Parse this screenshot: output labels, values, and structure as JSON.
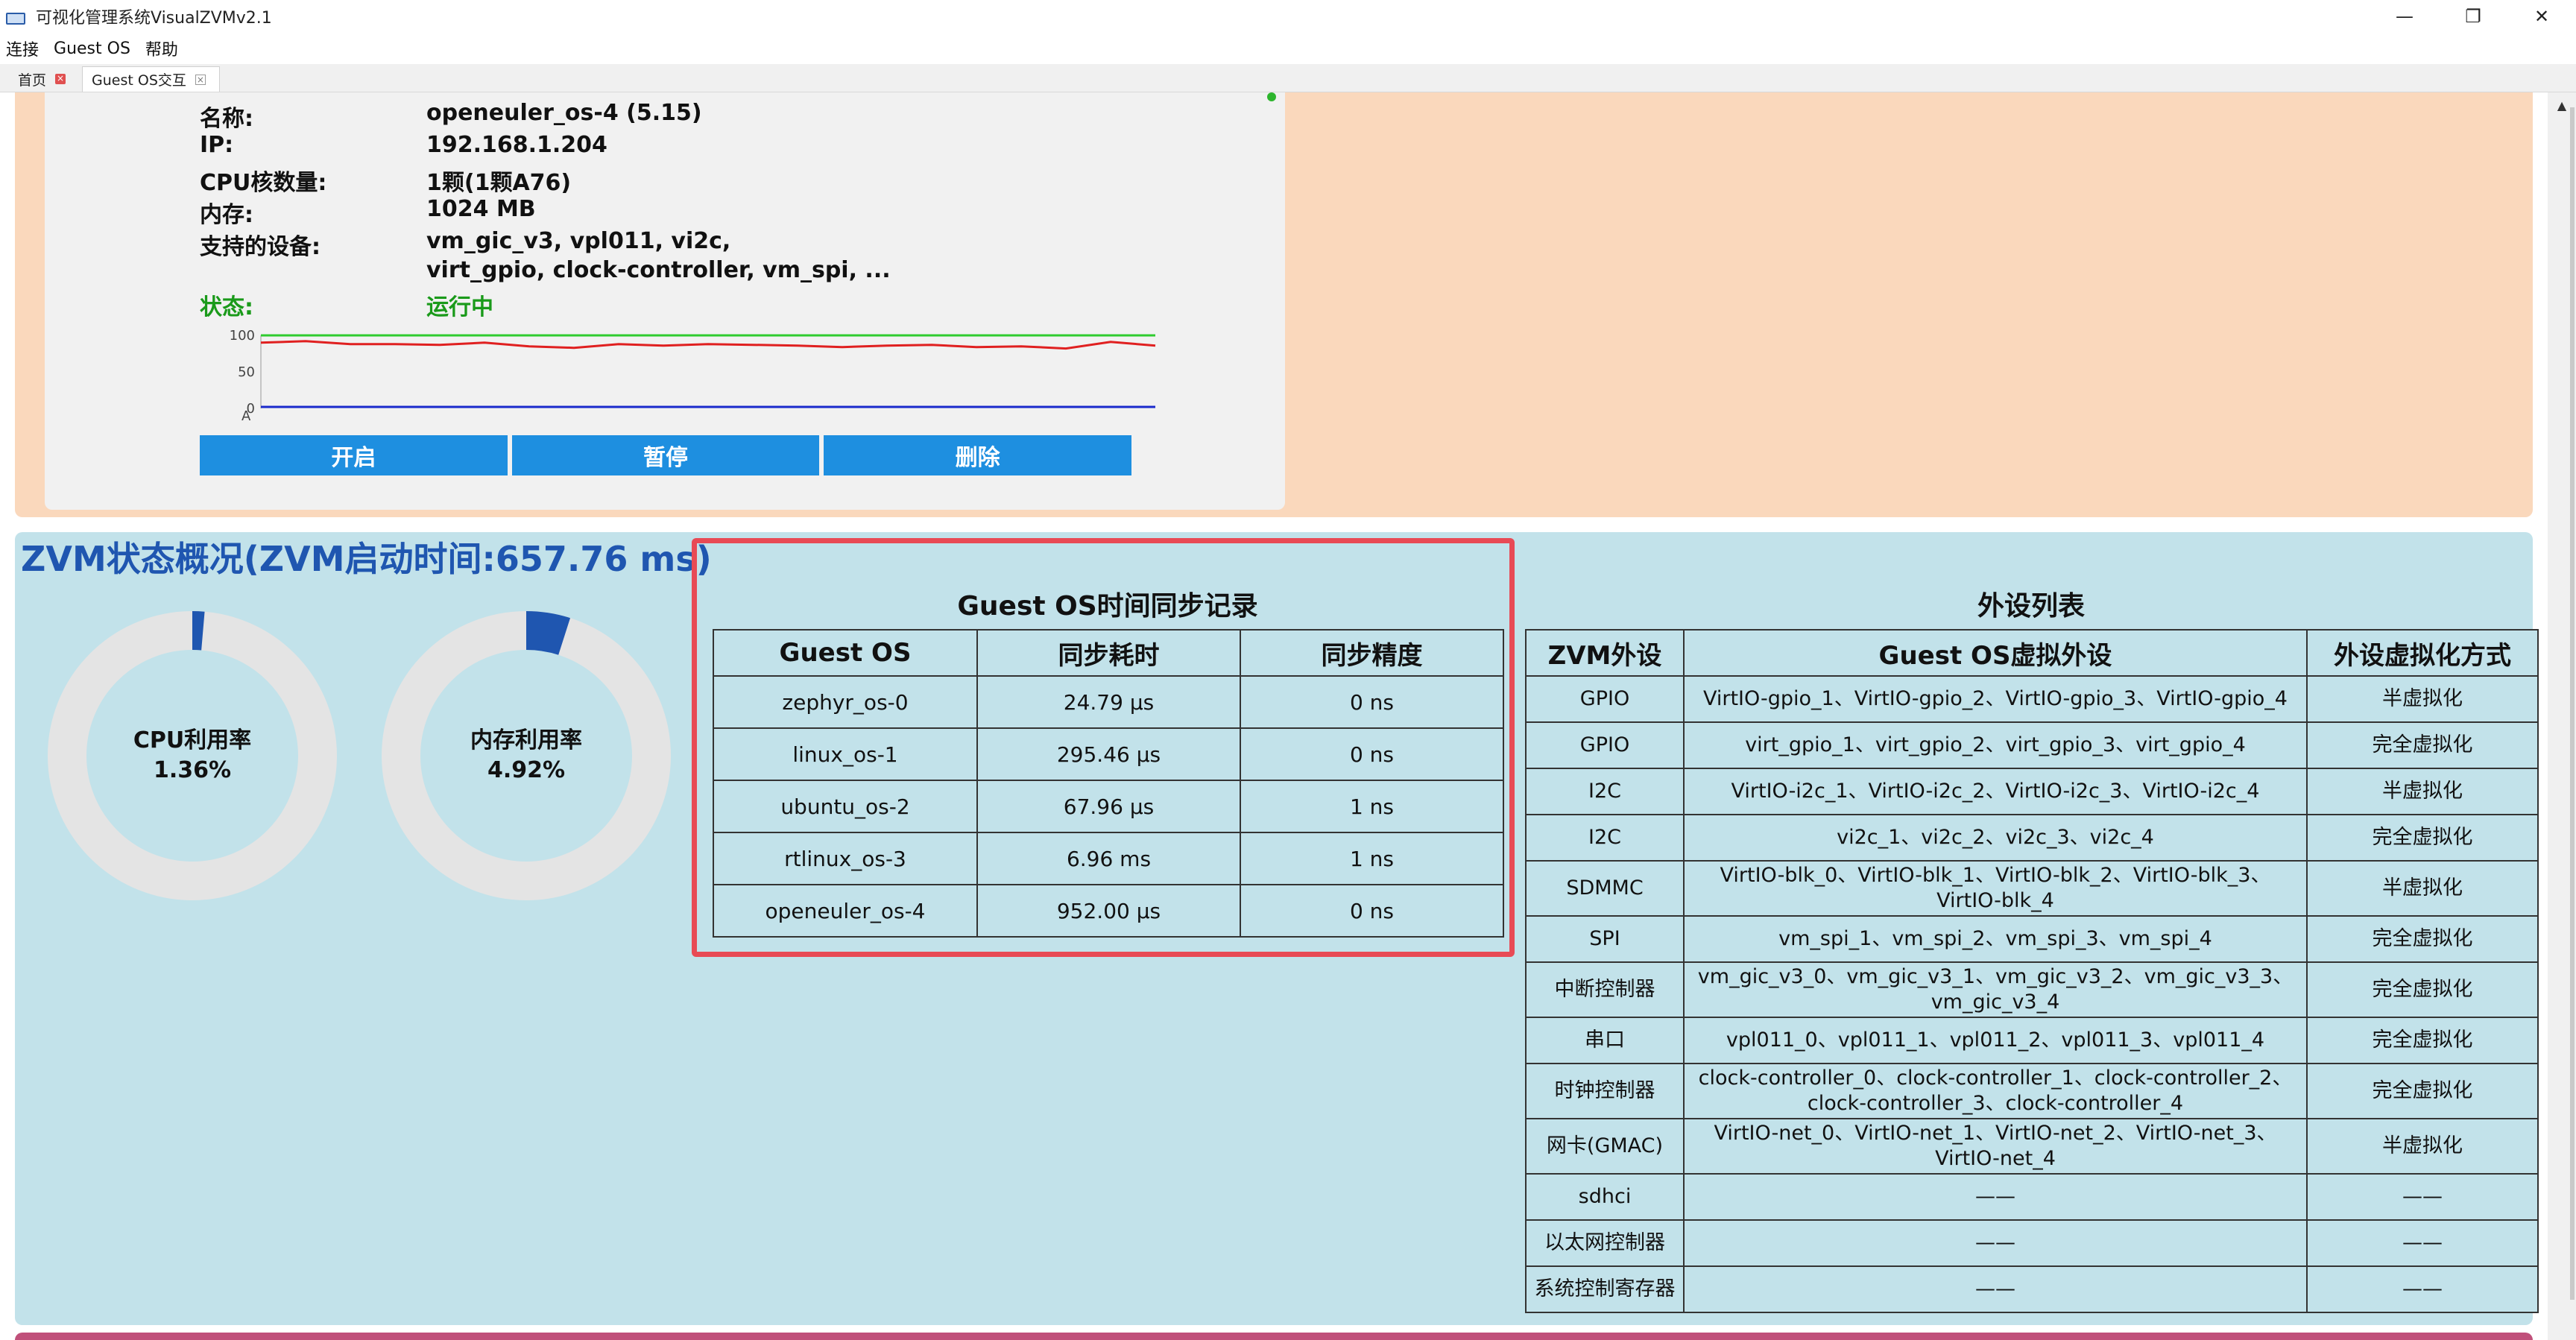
{
  "window": {
    "title": "可视化管理系统VisualZVMv2.1",
    "controls": [
      "—",
      "❐",
      "✕"
    ]
  },
  "menu": [
    "连接",
    "Guest OS",
    "帮助"
  ],
  "tabs": [
    {
      "label": "首页",
      "active": false
    },
    {
      "label": "Guest OS交互",
      "active": true
    }
  ],
  "vm": {
    "name_label": "名称:",
    "name": "openeuler_os-4 (5.15)",
    "ip_label": "IP:",
    "ip": "192.168.1.204",
    "cpu_label": "CPU核数量:",
    "cpu": "1颗(1颗A76)",
    "mem_label": "内存:",
    "mem": "1024 MB",
    "devices_label": "支持的设备:",
    "devices_line1": "vm_gic_v3, vpl011, vi2c,",
    "devices_line2": "virt_gpio, clock-controller, vm_spi, ...",
    "status_label": "状态:",
    "status": "运行中",
    "status_color": "#1a9a1a",
    "buttons": {
      "start": "开启",
      "pause": "暂停",
      "delete": "删除"
    }
  },
  "chart_data": {
    "type": "line",
    "title": "",
    "xlabel": "",
    "ylabel": "",
    "ylim": [
      0,
      100
    ],
    "yticks": [
      "100",
      "50",
      "0"
    ],
    "corner_icon": "A",
    "series": [
      {
        "color": "#2ecc2e",
        "values": [
          100,
          100,
          100,
          100,
          100,
          100,
          100,
          100,
          100,
          100,
          100,
          100,
          100,
          100,
          100,
          100,
          100,
          100,
          100,
          100
        ]
      },
      {
        "color": "#e02020",
        "values": [
          90,
          92,
          88,
          88,
          87,
          90,
          85,
          83,
          88,
          86,
          88,
          87,
          86,
          84,
          86,
          87,
          84,
          85,
          82,
          91,
          86
        ]
      },
      {
        "color": "#1a2acc",
        "values": [
          2,
          2,
          2,
          2,
          2,
          2,
          2,
          2,
          2,
          2,
          2,
          2,
          2,
          2,
          2,
          2,
          2,
          2,
          2,
          2
        ]
      }
    ]
  },
  "overview": {
    "title": "ZVM状态概况(ZVM启动时间:657.76 ms)",
    "cpu": {
      "label": "CPU利用率",
      "value": "1.36%",
      "fraction": 0.0136
    },
    "mem": {
      "label": "内存利用率",
      "value": "4.92%",
      "fraction": 0.0492
    },
    "gauge_track": "#e4e4e4",
    "gauge_fill": "#1f56b0"
  },
  "sync": {
    "title": "Guest OS时间同步记录",
    "headers": [
      "Guest OS",
      "同步耗时",
      "同步精度"
    ],
    "rows": [
      [
        "zephyr_os-0",
        "24.79 μs",
        "0 ns"
      ],
      [
        "linux_os-1",
        "295.46 μs",
        "0 ns"
      ],
      [
        "ubuntu_os-2",
        "67.96 μs",
        "1 ns"
      ],
      [
        "rtlinux_os-3",
        "6.96 ms",
        "1 ns"
      ],
      [
        "openeuler_os-4",
        "952.00 μs",
        "0 ns"
      ]
    ]
  },
  "peripherals": {
    "title": "外设列表",
    "headers": [
      "ZVM外设",
      "Guest OS虚拟外设",
      "外设虚拟化方式"
    ],
    "rows": [
      [
        "GPIO",
        "VirtIO-gpio_1、VirtIO-gpio_2、VirtIO-gpio_3、VirtIO-gpio_4",
        "半虚拟化"
      ],
      [
        "GPIO",
        "virt_gpio_1、virt_gpio_2、virt_gpio_3、virt_gpio_4",
        "完全虚拟化"
      ],
      [
        "I2C",
        "VirtIO-i2c_1、VirtIO-i2c_2、VirtIO-i2c_3、VirtIO-i2c_4",
        "半虚拟化"
      ],
      [
        "I2C",
        "vi2c_1、vi2c_2、vi2c_3、vi2c_4",
        "完全虚拟化"
      ],
      [
        "SDMMC",
        "VirtIO-blk_0、VirtIO-blk_1、VirtIO-blk_2、VirtIO-blk_3、VirtIO-blk_4",
        "半虚拟化"
      ],
      [
        "SPI",
        "vm_spi_1、vm_spi_2、vm_spi_3、vm_spi_4",
        "完全虚拟化"
      ],
      [
        "中断控制器",
        "vm_gic_v3_0、vm_gic_v3_1、vm_gic_v3_2、vm_gic_v3_3、vm_gic_v3_4",
        "完全虚拟化"
      ],
      [
        "串口",
        "vpl011_0、vpl011_1、vpl011_2、vpl011_3、vpl011_4",
        "完全虚拟化"
      ],
      [
        "时钟控制器",
        "clock-controller_0、clock-controller_1、clock-controller_2、clock-controller_3、clock-controller_4",
        "完全虚拟化"
      ],
      [
        "网卡(GMAC)",
        "VirtIO-net_0、VirtIO-net_1、VirtIO-net_2、VirtIO-net_3、VirtIO-net_4",
        "半虚拟化"
      ],
      [
        "sdhci",
        "——",
        "——"
      ],
      [
        "以太网控制器",
        "——",
        "——"
      ],
      [
        "系统控制寄存器",
        "——",
        "——"
      ]
    ]
  }
}
